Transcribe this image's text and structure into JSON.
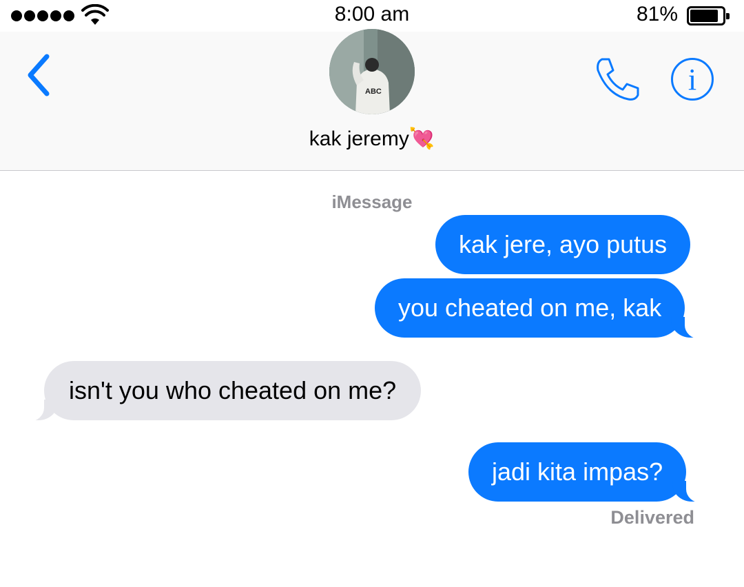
{
  "status_bar": {
    "time": "8:00 am",
    "battery_percent": "81%",
    "battery_level": 0.81,
    "signal_bars": 5,
    "wifi_icon": "wifi-icon"
  },
  "header": {
    "contact_name": "kak jeremy",
    "contact_emoji": "💘",
    "back_icon": "chevron-left-icon",
    "call_icon": "phone-icon",
    "info_icon": "info-icon",
    "info_glyph": "i"
  },
  "thread": {
    "service_label": "iMessage",
    "messages": [
      {
        "direction": "outgoing",
        "text": "kak jere, ayo putus"
      },
      {
        "direction": "outgoing",
        "text": "you cheated on me, kak"
      },
      {
        "direction": "incoming",
        "text": "isn't you who cheated on me?"
      },
      {
        "direction": "outgoing",
        "text": "jadi kita impas?"
      }
    ],
    "receipt": "Delivered"
  },
  "colors": {
    "accent": "#0b7aff",
    "incoming_bubble": "#e5e5ea",
    "secondary_text": "#8e8e93"
  }
}
